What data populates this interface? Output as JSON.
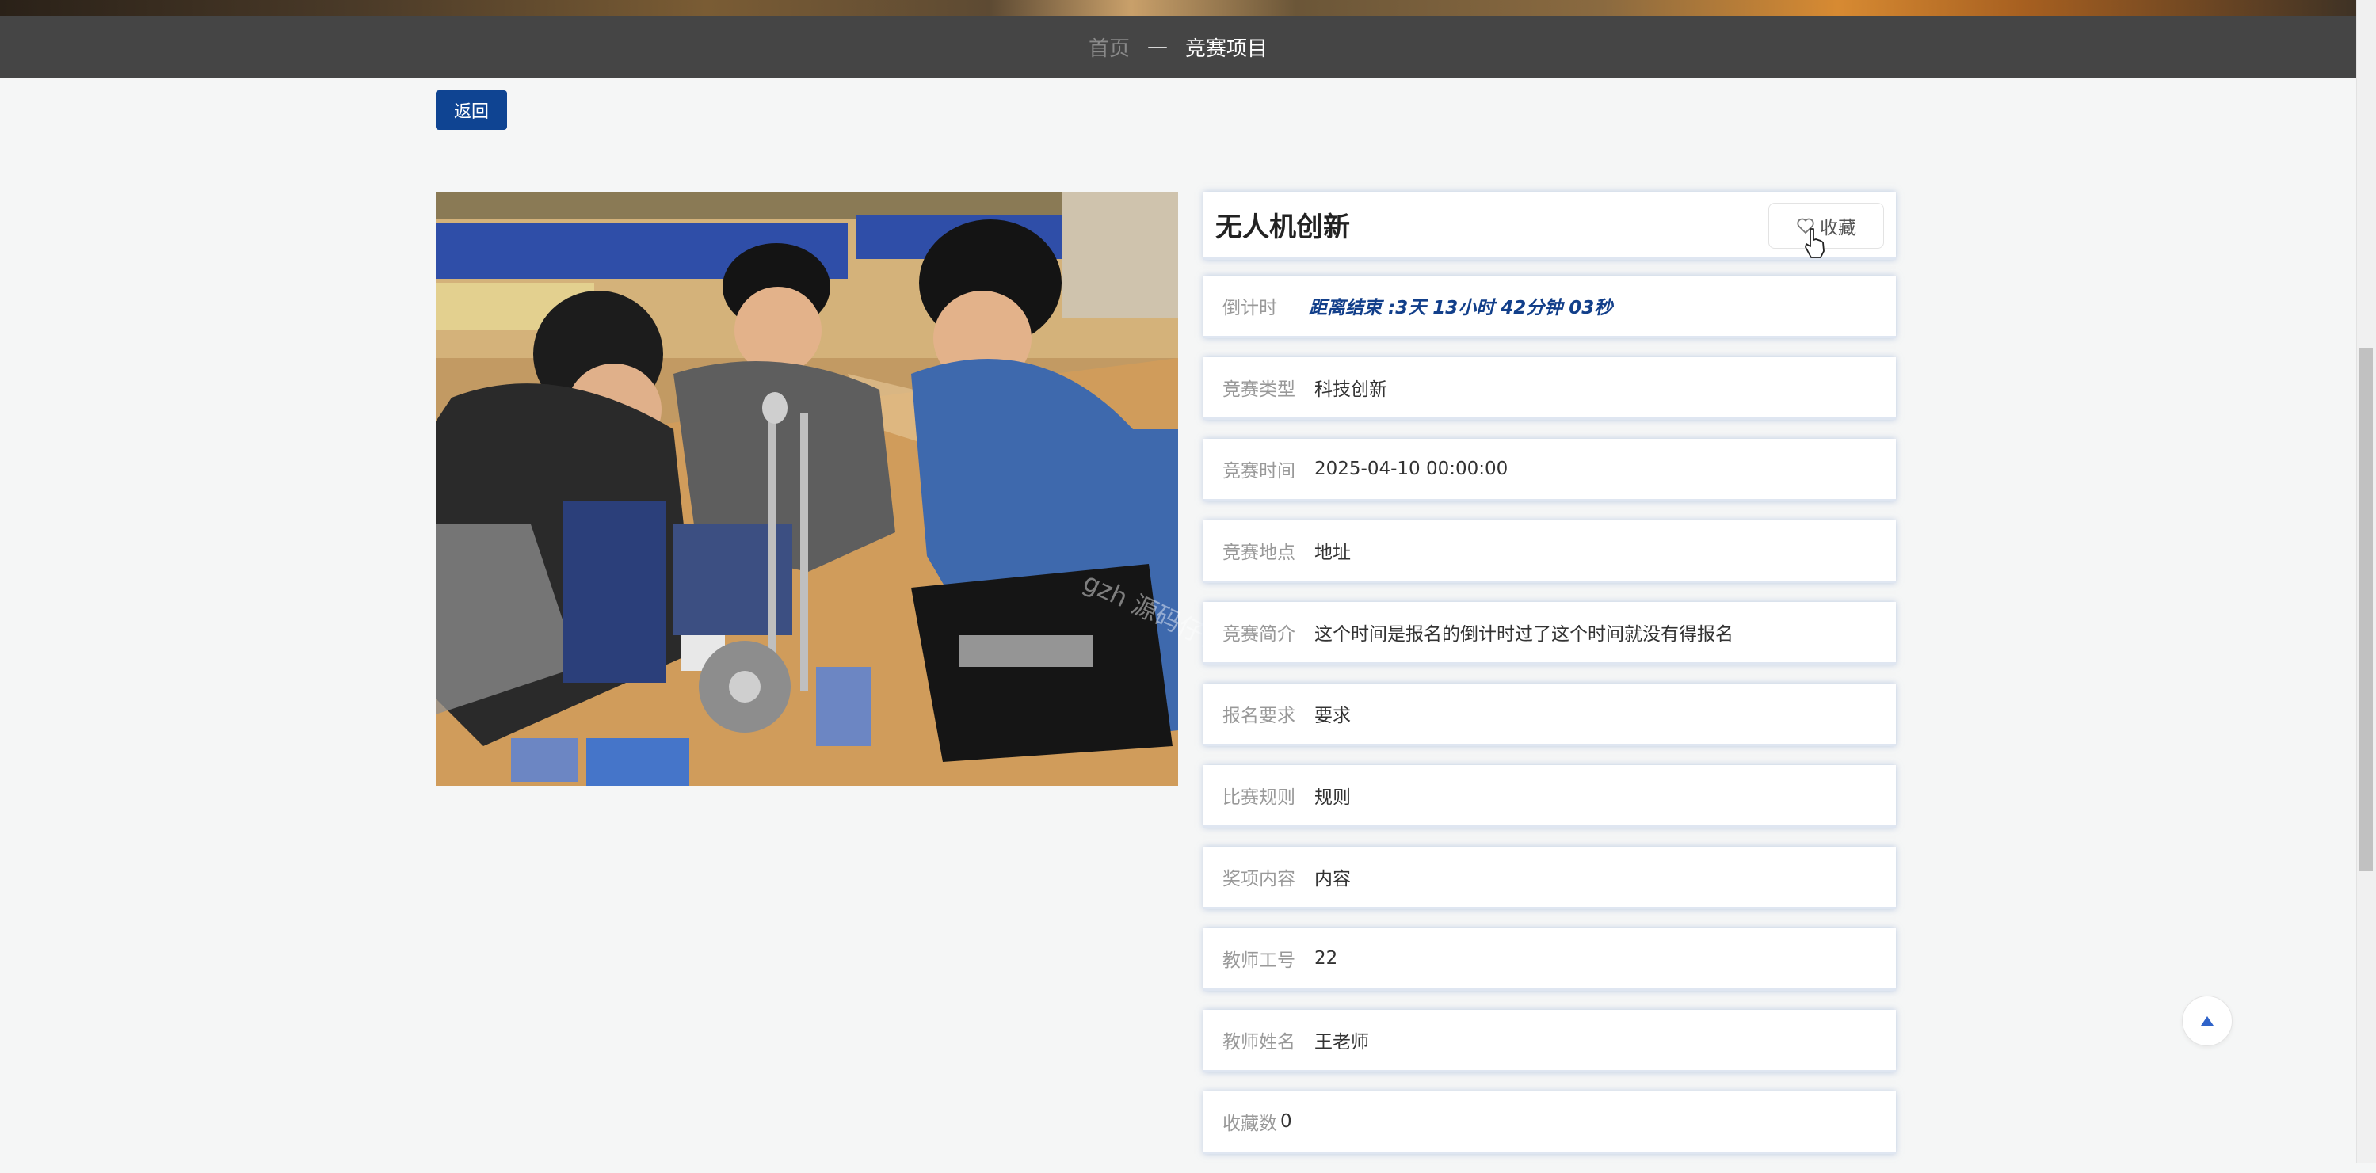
{
  "breadcrumb": {
    "home": "首页",
    "separator": "—",
    "current": "竞赛项目"
  },
  "back_button": "返回",
  "competition": {
    "title": "无人机创新",
    "favorite_label": "收藏",
    "countdown_label": "倒计时",
    "countdown_value": "距离结束 :3天 13小时 42分钟 03秒"
  },
  "fields": [
    {
      "label": "竞赛类型",
      "value": "科技创新"
    },
    {
      "label": "竞赛时间",
      "value": "2025-04-10 00:00:00"
    },
    {
      "label": "竞赛地点",
      "value": "地址"
    },
    {
      "label": "竞赛简介",
      "value": "这个时间是报名的倒计时过了这个时间就没有得报名"
    },
    {
      "label": "报名要求",
      "value": "要求"
    },
    {
      "label": "比赛规则",
      "value": "规则"
    },
    {
      "label": "奖项内容",
      "value": "内容"
    },
    {
      "label": "教师工号",
      "value": "22"
    },
    {
      "label": "教师姓名",
      "value": "王老师"
    },
    {
      "label": "收藏数",
      "value": "0"
    }
  ],
  "watermark": "gzh 源码仔优多",
  "icons": {
    "favorite": "heart-outline-icon",
    "scroll_top": "triangle-up-icon",
    "cursor": "hand-pointer-icon"
  },
  "colors": {
    "nav_background": "#454545",
    "primary_button": "#0f4492",
    "countdown_text": "#123f8a",
    "page_background": "#f5f6f6"
  }
}
